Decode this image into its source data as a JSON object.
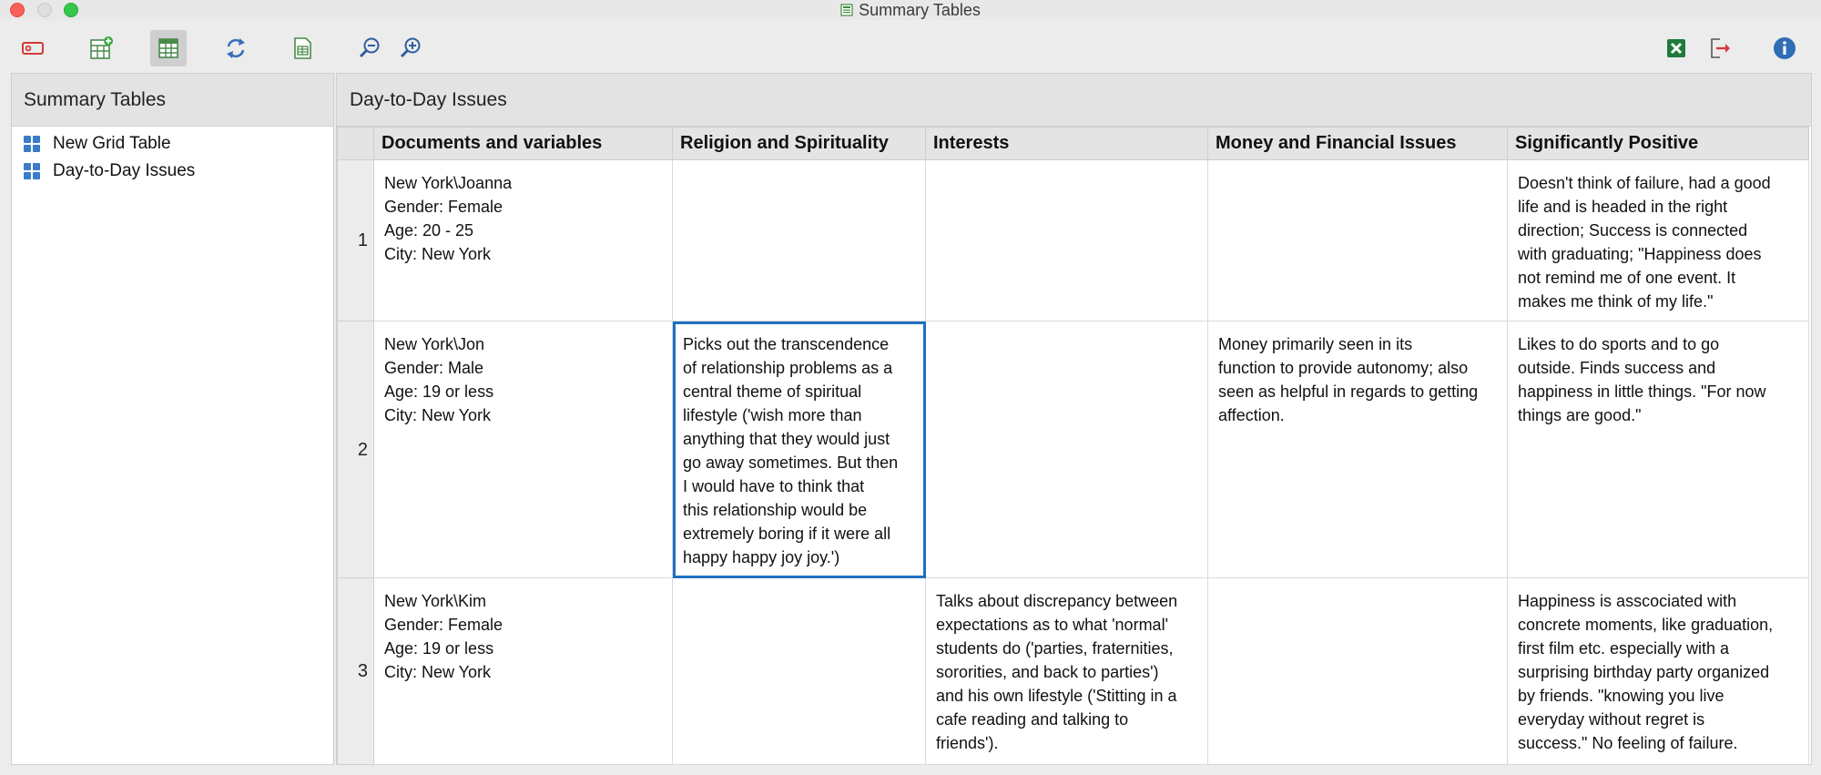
{
  "window": {
    "title": "Summary Tables"
  },
  "toolbar": {
    "buttons": [
      {
        "icon": "record-icon"
      },
      {
        "icon": "new-table-icon"
      },
      {
        "icon": "grid-table-icon"
      },
      {
        "icon": "refresh-icon"
      },
      {
        "icon": "document-table-icon"
      },
      {
        "icon": "zoom-out-icon"
      },
      {
        "icon": "zoom-in-icon"
      },
      {
        "icon": "excel-export-icon"
      },
      {
        "icon": "export-icon"
      },
      {
        "icon": "info-icon"
      }
    ]
  },
  "sidebar": {
    "title": "Summary Tables",
    "items": [
      {
        "label": "New Grid Table"
      },
      {
        "label": "Day-to-Day Issues"
      }
    ]
  },
  "main": {
    "title": "Day-to-Day Issues",
    "columns": [
      "Documents and variables",
      "Religion and Spirituality",
      "Interests",
      "Money and Financial Issues",
      "Significantly Positive"
    ],
    "rows": [
      {
        "num": "1",
        "doc": [
          "New York\\Joanna",
          "Gender: Female",
          "Age: 20 - 25",
          "City: New York"
        ],
        "religion": [],
        "interests": [],
        "money": [],
        "positive": [
          "Doesn't think of failure, had a good",
          "life and is headed in the right",
          "direction; Success is connected",
          "with graduating; \"Happiness does",
          "not remind me of one event. It",
          "makes me think of my life.\""
        ]
      },
      {
        "num": "2",
        "doc": [
          "New York\\Jon",
          "Gender: Male",
          "Age: 19 or less",
          "City: New York"
        ],
        "religion": [
          "Picks out the transcendence",
          "of relationship problems as a",
          "central theme of spiritual",
          "lifestyle ('wish more than",
          "anything that they would just",
          "go away sometimes. But then",
          "I would have to think that",
          "this relationship would be",
          "extremely boring if it were all",
          "happy happy joy joy.')"
        ],
        "interests": [],
        "money": [
          "Money primarily seen in its",
          "function to provide autonomy; also",
          "seen as helpful in regards to getting",
          "affection."
        ],
        "positive": [
          "Likes to do sports and to go",
          "outside. Finds success and",
          "happiness in little things. \"For now",
          "things are good.\""
        ]
      },
      {
        "num": "3",
        "doc": [
          "New York\\Kim",
          "Gender: Female",
          "Age: 19 or less",
          "City: New York"
        ],
        "religion": [],
        "interests": [
          "Talks about discrepancy between",
          "expectations as to what 'normal'",
          "students do ('parties, fraternities,",
          "sororities, and back to parties')",
          "and his own lifestyle ('Stitting in a",
          "cafe reading and talking to",
          "friends')."
        ],
        "money": [],
        "positive": [
          "Happiness is asscociated with",
          "concrete moments, like graduation,",
          "first film etc. especially with a",
          "surprising birthday party organized",
          "by friends. \"knowing you live",
          "everyday without regret is",
          "success.\" No feeling of failure."
        ]
      }
    ]
  },
  "colors": {
    "accent": "#1f6fc1",
    "header_bg": "#e4e4e4"
  }
}
